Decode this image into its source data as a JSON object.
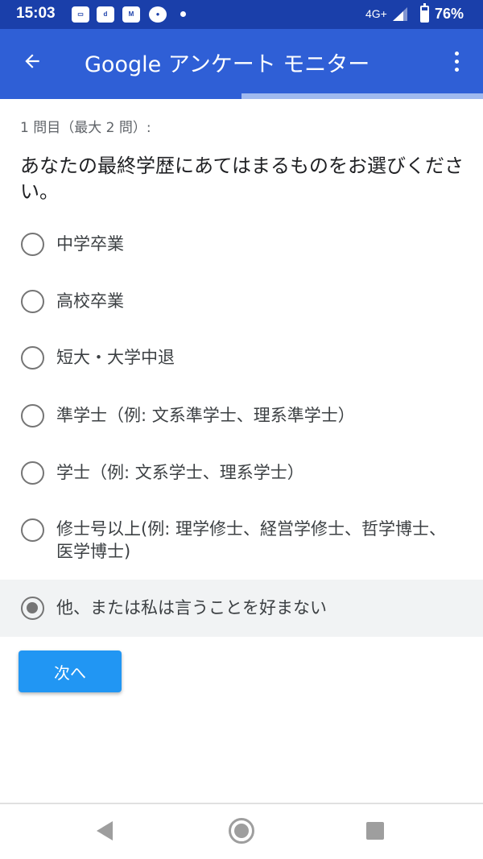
{
  "status_bar": {
    "time": "15:03",
    "notification_icons": [
      "mobile-app-notification-icon",
      "d-app-notification-icon",
      "gmail-icon",
      "shopping-app-notification-icon",
      "more-notifications-dot"
    ],
    "network": "4G+",
    "battery_level": 76,
    "battery_percent": "76%"
  },
  "app_bar": {
    "title": "Google アンケート モニター",
    "back_icon": "arrow-back-icon",
    "menu_icon": "more-vert-icon"
  },
  "progress": {
    "value": 0.5
  },
  "survey": {
    "counter": "1 問目（最大 2 問）:",
    "question": "あなたの最終学歴にあてはまるものをお選びください。",
    "options": [
      {
        "label": "中学卒業",
        "selected": false
      },
      {
        "label": "高校卒業",
        "selected": false
      },
      {
        "label": "短大・大学中退",
        "selected": false
      },
      {
        "label": "準学士（例: 文系準学士、理系準学士）",
        "selected": false
      },
      {
        "label": "学士（例: 文系学士、理系学士）",
        "selected": false
      },
      {
        "label": "修士号以上(例: 理学修士、経営学修士、哲学博士、医学博士)",
        "selected": false
      },
      {
        "label": "他、または私は言うことを好まない",
        "selected": true
      }
    ],
    "next_label": "次へ"
  },
  "nav_bar": {
    "back_icon": "nav-back-icon",
    "home_icon": "nav-home-icon",
    "recents_icon": "nav-recents-icon"
  },
  "colors": {
    "status_bar": "#1a3faa",
    "app_bar": "#2f5fd6",
    "progress_track": "#9fb9ef",
    "next_button": "#2196f3",
    "selected_row": "#f1f3f4"
  }
}
